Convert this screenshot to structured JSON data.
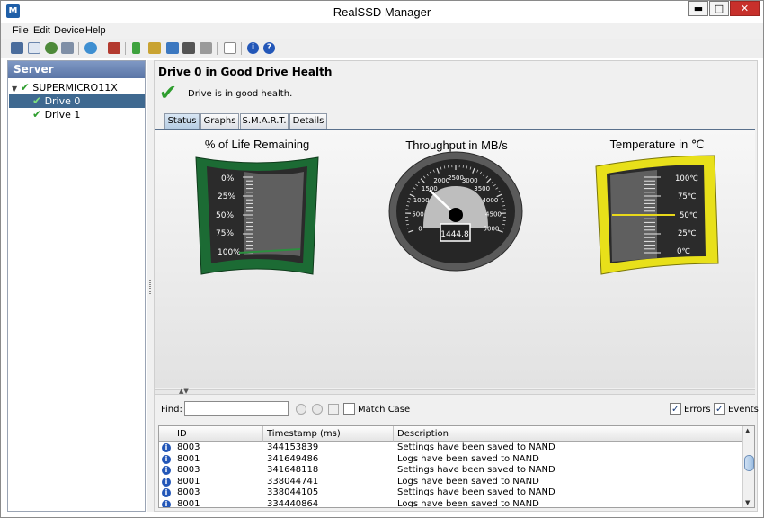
{
  "window": {
    "title": "RealSSD Manager",
    "icon": "M"
  },
  "window_buttons": {
    "minimize": "▬",
    "maximize": "□",
    "close": "✕"
  },
  "menu": [
    "File",
    "Edit",
    "Device",
    "Help"
  ],
  "toolbar_icons": [
    "disk-icon",
    "page-icon",
    "bug-icon",
    "device-icon",
    "refresh-icon",
    "tools-icon",
    "battery-icon",
    "broom-icon",
    "upload-icon",
    "terminal-icon",
    "folder-icon",
    "document-icon",
    "info-icon",
    "help-icon"
  ],
  "sidebar": {
    "header": "Server",
    "server": "SUPERMICRO11X",
    "drives": [
      "Drive 0",
      "Drive 1"
    ],
    "selected": "Drive 0"
  },
  "main": {
    "title": "Drive 0 in Good Drive Health",
    "message": "Drive is in good health.",
    "tabs": [
      "Status",
      "Graphs",
      "S.M.A.R.T.",
      "Details"
    ],
    "active_tab": "Status"
  },
  "gauges": {
    "life": {
      "label": "% of Life Remaining",
      "ticks": [
        "0%",
        "25%",
        "50%",
        "75%",
        "100%"
      ],
      "value_percent": 100,
      "colors": {
        "frame": "#1c6b34",
        "face": "#2a2a2a",
        "indicator": "#2c8f3f"
      }
    },
    "throughput": {
      "label": "Throughput in MB/s",
      "ticks": [
        "0",
        "500",
        "1000",
        "1500",
        "2000",
        "2500",
        "3000",
        "3500",
        "4000",
        "4500",
        "5000"
      ],
      "min": 0,
      "max": 5000,
      "value": 1444.8,
      "readout": "1444.8"
    },
    "temperature": {
      "label": "Temperature in ℃",
      "ticks": [
        "100℃",
        "75℃",
        "50℃",
        "25℃",
        "0℃"
      ],
      "value_celsius": 50,
      "colors": {
        "frame": "#e8e01a",
        "indicator": "#e8d81a"
      }
    }
  },
  "log_panel": {
    "find_label": "Find:",
    "find_value": "",
    "match_case_label": "Match Case",
    "match_case_checked": false,
    "errors_label": "Errors",
    "errors_checked": true,
    "events_label": "Events",
    "events_checked": true,
    "columns": [
      "ID",
      "Timestamp (ms)",
      "Description"
    ],
    "rows": [
      {
        "id": "8003",
        "timestamp": "344153839",
        "description": "Settings have been saved to NAND"
      },
      {
        "id": "8001",
        "timestamp": "341649486",
        "description": "Logs have been saved to NAND"
      },
      {
        "id": "8003",
        "timestamp": "341648118",
        "description": "Settings have been saved to NAND"
      },
      {
        "id": "8001",
        "timestamp": "338044741",
        "description": "Logs have been saved to NAND"
      },
      {
        "id": "8003",
        "timestamp": "338044105",
        "description": "Settings have been saved to NAND"
      },
      {
        "id": "8001",
        "timestamp": "334440864",
        "description": "Logs have been saved to NAND"
      }
    ]
  }
}
